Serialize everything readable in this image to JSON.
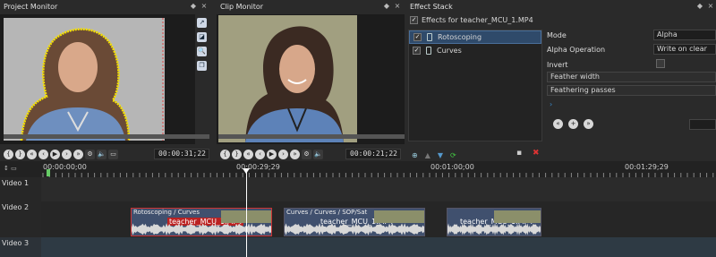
{
  "project_monitor": {
    "title": "Project Monitor",
    "timecode": "00:00:31;22"
  },
  "clip_monitor": {
    "title": "Clip Monitor",
    "timecode": "00:00:21;22"
  },
  "effect_stack": {
    "title": "Effect Stack",
    "effects_for_label": "Effects for teacher_MCU_1.MP4",
    "effects": [
      {
        "label": "Rotoscoping",
        "checked": true,
        "selected": true
      },
      {
        "label": "Curves",
        "checked": true,
        "selected": false
      }
    ],
    "properties": {
      "mode_label": "Mode",
      "mode_value": "Alpha",
      "alpha_op_label": "Alpha Operation",
      "alpha_op_value": "Write on clear",
      "invert_label": "Invert",
      "feather_width_label": "Feather width",
      "feathering_passes_label": "Feathering passes"
    }
  },
  "timeline": {
    "ruler_labels": [
      "00:00:00;00",
      "00:00:29;29",
      "00:01:00;00",
      "00:01:29;29"
    ],
    "tracks": [
      {
        "label": "Video 1"
      },
      {
        "label": "Video 2"
      },
      {
        "label": "Video 3"
      }
    ],
    "clips": [
      {
        "title": "Rotoscoping / Curves",
        "name": "teacher_MCU_1.MP4"
      },
      {
        "title": "Curves / Curves / SOP/Sat",
        "name": "teacher_MCU_1.MP4"
      },
      {
        "title": "",
        "name": "teacher_MCU_1.MP4"
      }
    ]
  },
  "colors": {
    "accent": "#2f4a6a",
    "playhead": "#ffffff",
    "clip_selected_border": "#cc3333"
  }
}
